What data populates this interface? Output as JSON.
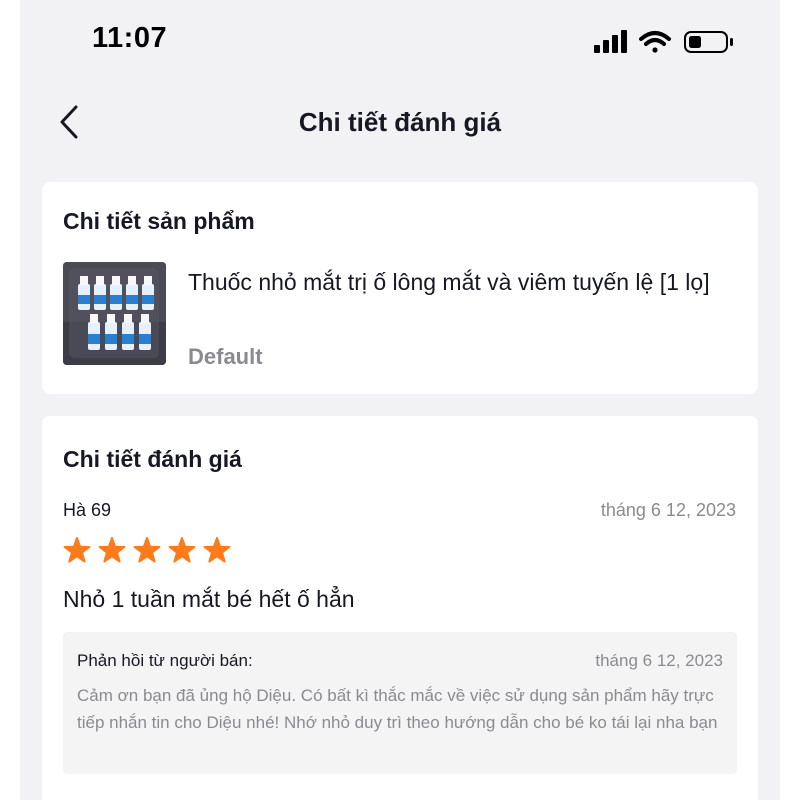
{
  "status_bar": {
    "time": "11:07",
    "icons": [
      "cellular-signal-icon",
      "wifi-icon",
      "battery-icon"
    ]
  },
  "nav": {
    "title": "Chi tiết đánh giá",
    "back_icon": "chevron-left-icon"
  },
  "product_card": {
    "title": "Chi tiết sản phẩm",
    "product_name": "Thuốc nhỏ mắt trị ố lông mắt và viêm tuyến lệ [1 lọ]",
    "variant": "Default"
  },
  "review_card": {
    "title": "Chi tiết đánh giá",
    "reviewer": "Hà 69",
    "date": "tháng 6 12, 2023",
    "rating": 5,
    "rating_max": 5,
    "text": "Nhỏ 1 tuần mắt bé hết ố hẳn",
    "seller_reply": {
      "label": "Phản hồi từ người bán:",
      "date": "tháng 6 12, 2023",
      "text": "Cảm ơn bạn đã ủng hộ Diệu. Có bất kì thắc mắc về việc sử dụng sản phẩm hãy trực tiếp nhắn tin cho Diệu nhé! Nhớ nhỏ duy trì theo hướng dẫn cho bé ko tái lại nha bạn"
    }
  },
  "colors": {
    "background": "#f2f2f4",
    "card": "#ffffff",
    "text_primary": "#161823",
    "text_secondary": "#8a8b91",
    "star": "#fe7b1c",
    "reply_bg": "#f4f4f5"
  }
}
